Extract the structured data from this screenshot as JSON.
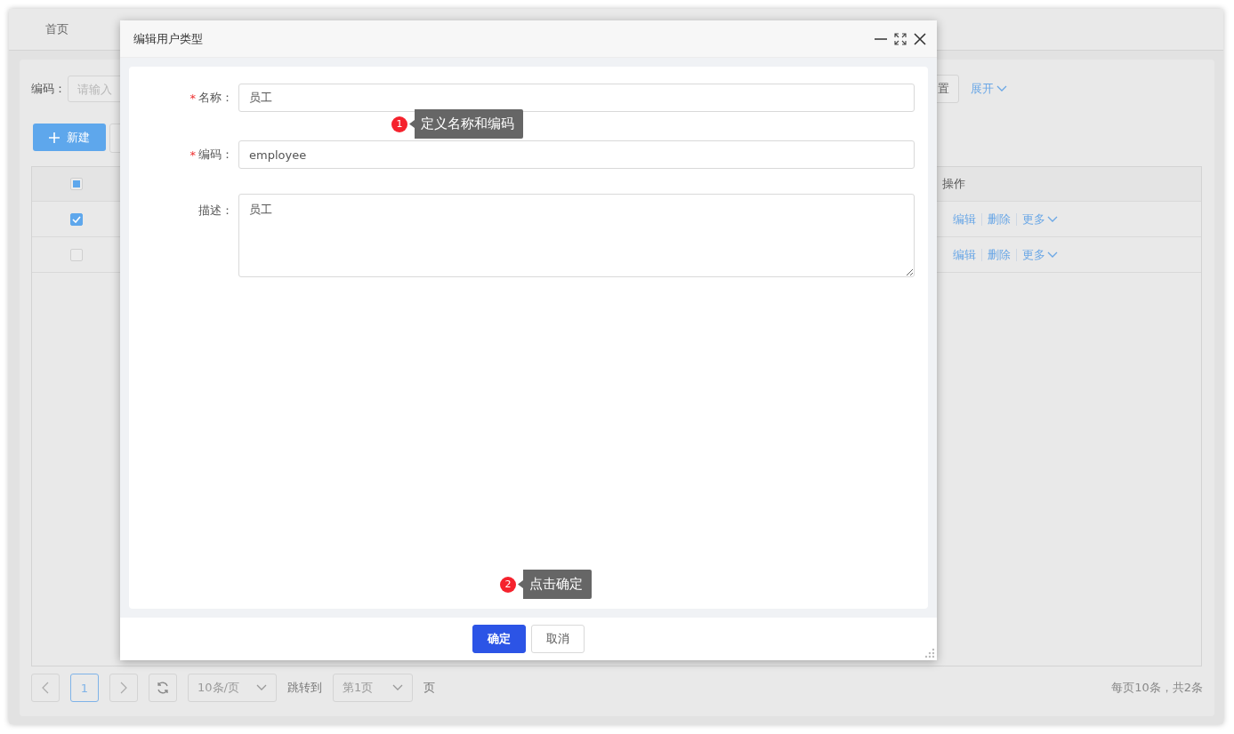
{
  "tabs": [
    {
      "label": "首页"
    }
  ],
  "filter": {
    "label": "编码：",
    "placeholder": "请输入",
    "reset_button": "置",
    "expand_link": "展开"
  },
  "toolbar": {
    "new_button": "新建"
  },
  "table": {
    "header_checkbox": {
      "indeterminate": true
    },
    "action_column": "操作",
    "rows": [
      {
        "checked": true,
        "actions": [
          "编辑",
          "删除",
          "更多"
        ]
      },
      {
        "checked": false,
        "actions": [
          "编辑",
          "删除",
          "更多"
        ]
      }
    ]
  },
  "pagination": {
    "pages": [
      {
        "label": "1",
        "selected": true
      }
    ],
    "page_size": "10条/页",
    "jump_label": "跳转到",
    "jump_value": "第1页",
    "page_suffix": "页",
    "summary": "每页10条，共2条"
  },
  "modal": {
    "title": "编辑用户类型",
    "fields": [
      {
        "kind": "input",
        "required_mark": "*",
        "label": "名称：",
        "value": "员工"
      },
      {
        "kind": "input",
        "required_mark": "*",
        "label": "编码：",
        "value": "employee"
      },
      {
        "kind": "textarea",
        "label": "描述：",
        "value": "员工"
      }
    ],
    "buttons": [
      {
        "label": "确定",
        "primary": true
      },
      {
        "label": "取消",
        "primary": false
      }
    ]
  },
  "annotations": [
    {
      "number": "1",
      "text": "定义名称和编码"
    },
    {
      "number": "2",
      "text": "点击确定"
    }
  ]
}
